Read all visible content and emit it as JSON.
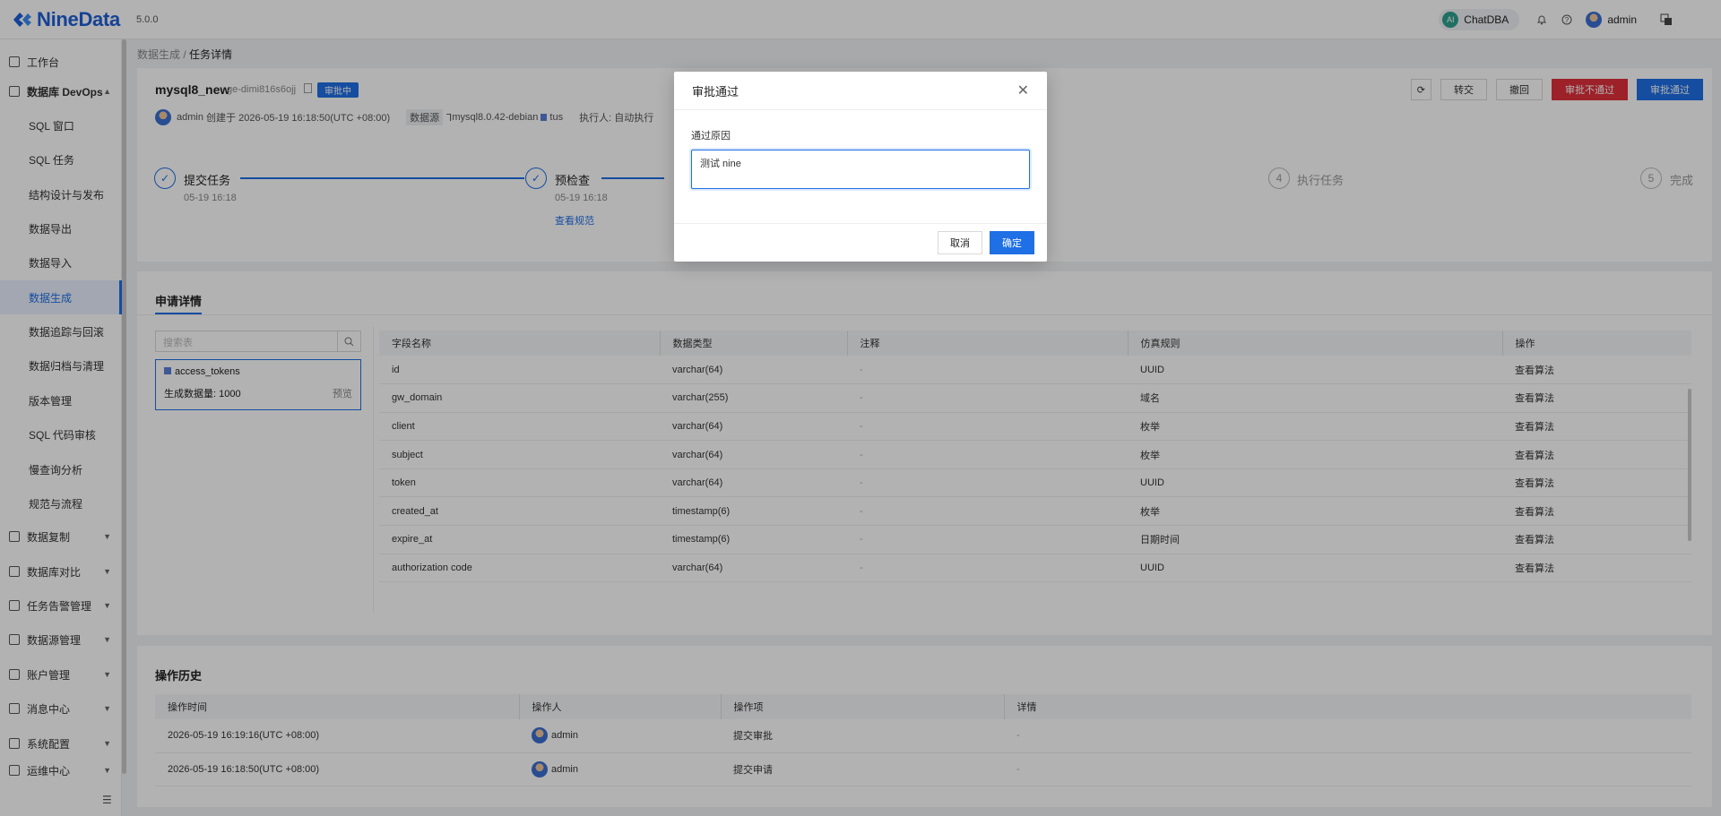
{
  "app": {
    "name": "NineData",
    "version": "5.0.0"
  },
  "topbar": {
    "chatdba": "ChatDBA",
    "ai_badge": "AI",
    "user": "admin",
    "icons": [
      "bell-icon",
      "help-icon",
      "language-icon"
    ]
  },
  "sidebar": {
    "workbench": "工作台",
    "devops": "数据库 DevOps",
    "sub_items": [
      "SQL 窗口",
      "SQL 任务",
      "结构设计与发布",
      "数据导出",
      "数据导入",
      "数据生成",
      "数据追踪与回滚",
      "数据归档与清理",
      "版本管理",
      "SQL 代码审核",
      "慢查询分析",
      "规范与流程"
    ],
    "groups": [
      "数据复制",
      "数据库对比",
      "任务告警管理",
      "数据源管理",
      "账户管理",
      "消息中心",
      "系统配置",
      "运维中心"
    ],
    "active": "数据生成"
  },
  "breadcrumb": {
    "parent": "数据生成",
    "sep": "/",
    "current": "任务详情"
  },
  "task": {
    "title": "mysql8_new",
    "id": "ge-dimi816s6ojj",
    "status": "审批中",
    "creator": "admin",
    "created_text": "创建于 2026-05-19 16:18:50(UTC +08:00)",
    "datasource_label": "数据源",
    "datasource": "mysql8.0.42-debian",
    "database": "tus",
    "executor_label": "执行人:",
    "executor": "自动执行"
  },
  "actions": {
    "transfer": "转交",
    "withdraw": "撤回",
    "reject": "审批不通过",
    "approve": "审批通过"
  },
  "steps": [
    {
      "label": "提交任务",
      "date": "05-19 16:18"
    },
    {
      "label": "预检查",
      "date": "05-19 16:18",
      "link": "查看规范"
    },
    {
      "num": "4",
      "label": "执行任务"
    },
    {
      "num": "5",
      "label": "完成"
    }
  ],
  "detail": {
    "title": "申请详情",
    "search_placeholder": "搜索表",
    "table_name": "access_tokens",
    "count_label": "生成数据量: 1000",
    "preview": "预览",
    "headers": [
      "字段名称",
      "数据类型",
      "注释",
      "仿真规则",
      "操作"
    ],
    "rows": [
      [
        "id",
        "varchar(64)",
        "-",
        "UUID",
        "查看算法"
      ],
      [
        "gw_domain",
        "varchar(255)",
        "-",
        "域名",
        "查看算法"
      ],
      [
        "client",
        "varchar(64)",
        "-",
        "枚举",
        "查看算法"
      ],
      [
        "subject",
        "varchar(64)",
        "-",
        "枚举",
        "查看算法"
      ],
      [
        "token",
        "varchar(64)",
        "-",
        "UUID",
        "查看算法"
      ],
      [
        "created_at",
        "timestamp(6)",
        "-",
        "枚举",
        "查看算法"
      ],
      [
        "expire_at",
        "timestamp(6)",
        "-",
        "日期时间",
        "查看算法"
      ],
      [
        "authorization code",
        "varchar(64)",
        "-",
        "UUID",
        "查看算法"
      ]
    ]
  },
  "history": {
    "title": "操作历史",
    "headers": [
      "操作时间",
      "操作人",
      "操作项",
      "详情"
    ],
    "rows": [
      [
        "2026-05-19 16:19:16(UTC +08:00)",
        "admin",
        "提交审批",
        "-"
      ],
      [
        "2026-05-19 16:18:50(UTC +08:00)",
        "admin",
        "提交申请",
        "-"
      ]
    ]
  },
  "modal": {
    "title": "审批通过",
    "label": "通过原因",
    "value": "测试 nine",
    "cancel": "取消",
    "confirm": "确定"
  }
}
